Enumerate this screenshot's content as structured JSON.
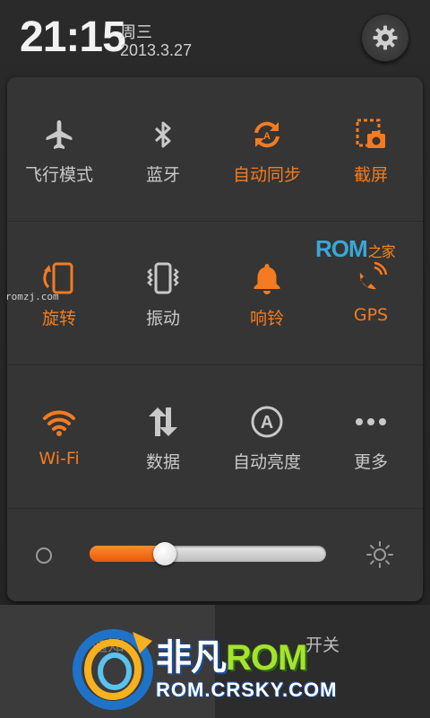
{
  "header": {
    "time": "21:15",
    "weekday": "周三",
    "date": "2013.3.27",
    "settings_icon": "gear-icon"
  },
  "toggles": [
    [
      {
        "label": "飞行模式",
        "icon": "airplane-icon",
        "on": false
      },
      {
        "label": "蓝牙",
        "icon": "bluetooth-icon",
        "on": false
      },
      {
        "label": "自动同步",
        "icon": "sync-icon",
        "on": true
      },
      {
        "label": "截屏",
        "icon": "screenshot-icon",
        "on": true
      }
    ],
    [
      {
        "label": "旋转",
        "icon": "rotate-icon",
        "on": true
      },
      {
        "label": "振动",
        "icon": "vibrate-icon",
        "on": false
      },
      {
        "label": "响铃",
        "icon": "bell-icon",
        "on": true
      },
      {
        "label": "GPS",
        "icon": "gps-icon",
        "on": true
      }
    ],
    [
      {
        "label": "Wi-Fi",
        "icon": "wifi-icon",
        "on": true
      },
      {
        "label": "数据",
        "icon": "data-icon",
        "on": false
      },
      {
        "label": "自动亮度",
        "icon": "auto-brightness-icon",
        "on": false
      },
      {
        "label": "更多",
        "icon": "more-icon",
        "on": false
      }
    ]
  ],
  "brightness": {
    "level": 0.32
  },
  "tabs": {
    "left": "通知",
    "right": "开关"
  },
  "watermarks": {
    "rom_home_main": "ROM",
    "rom_home_suffix": "之家",
    "romzj": "romzj.com",
    "brand_part1": "非凡",
    "brand_part2": "ROM",
    "brand_url": "ROM.CRSKY.COM"
  },
  "colors": {
    "accent": "#f47b20",
    "inactive": "#c9c9c9"
  }
}
